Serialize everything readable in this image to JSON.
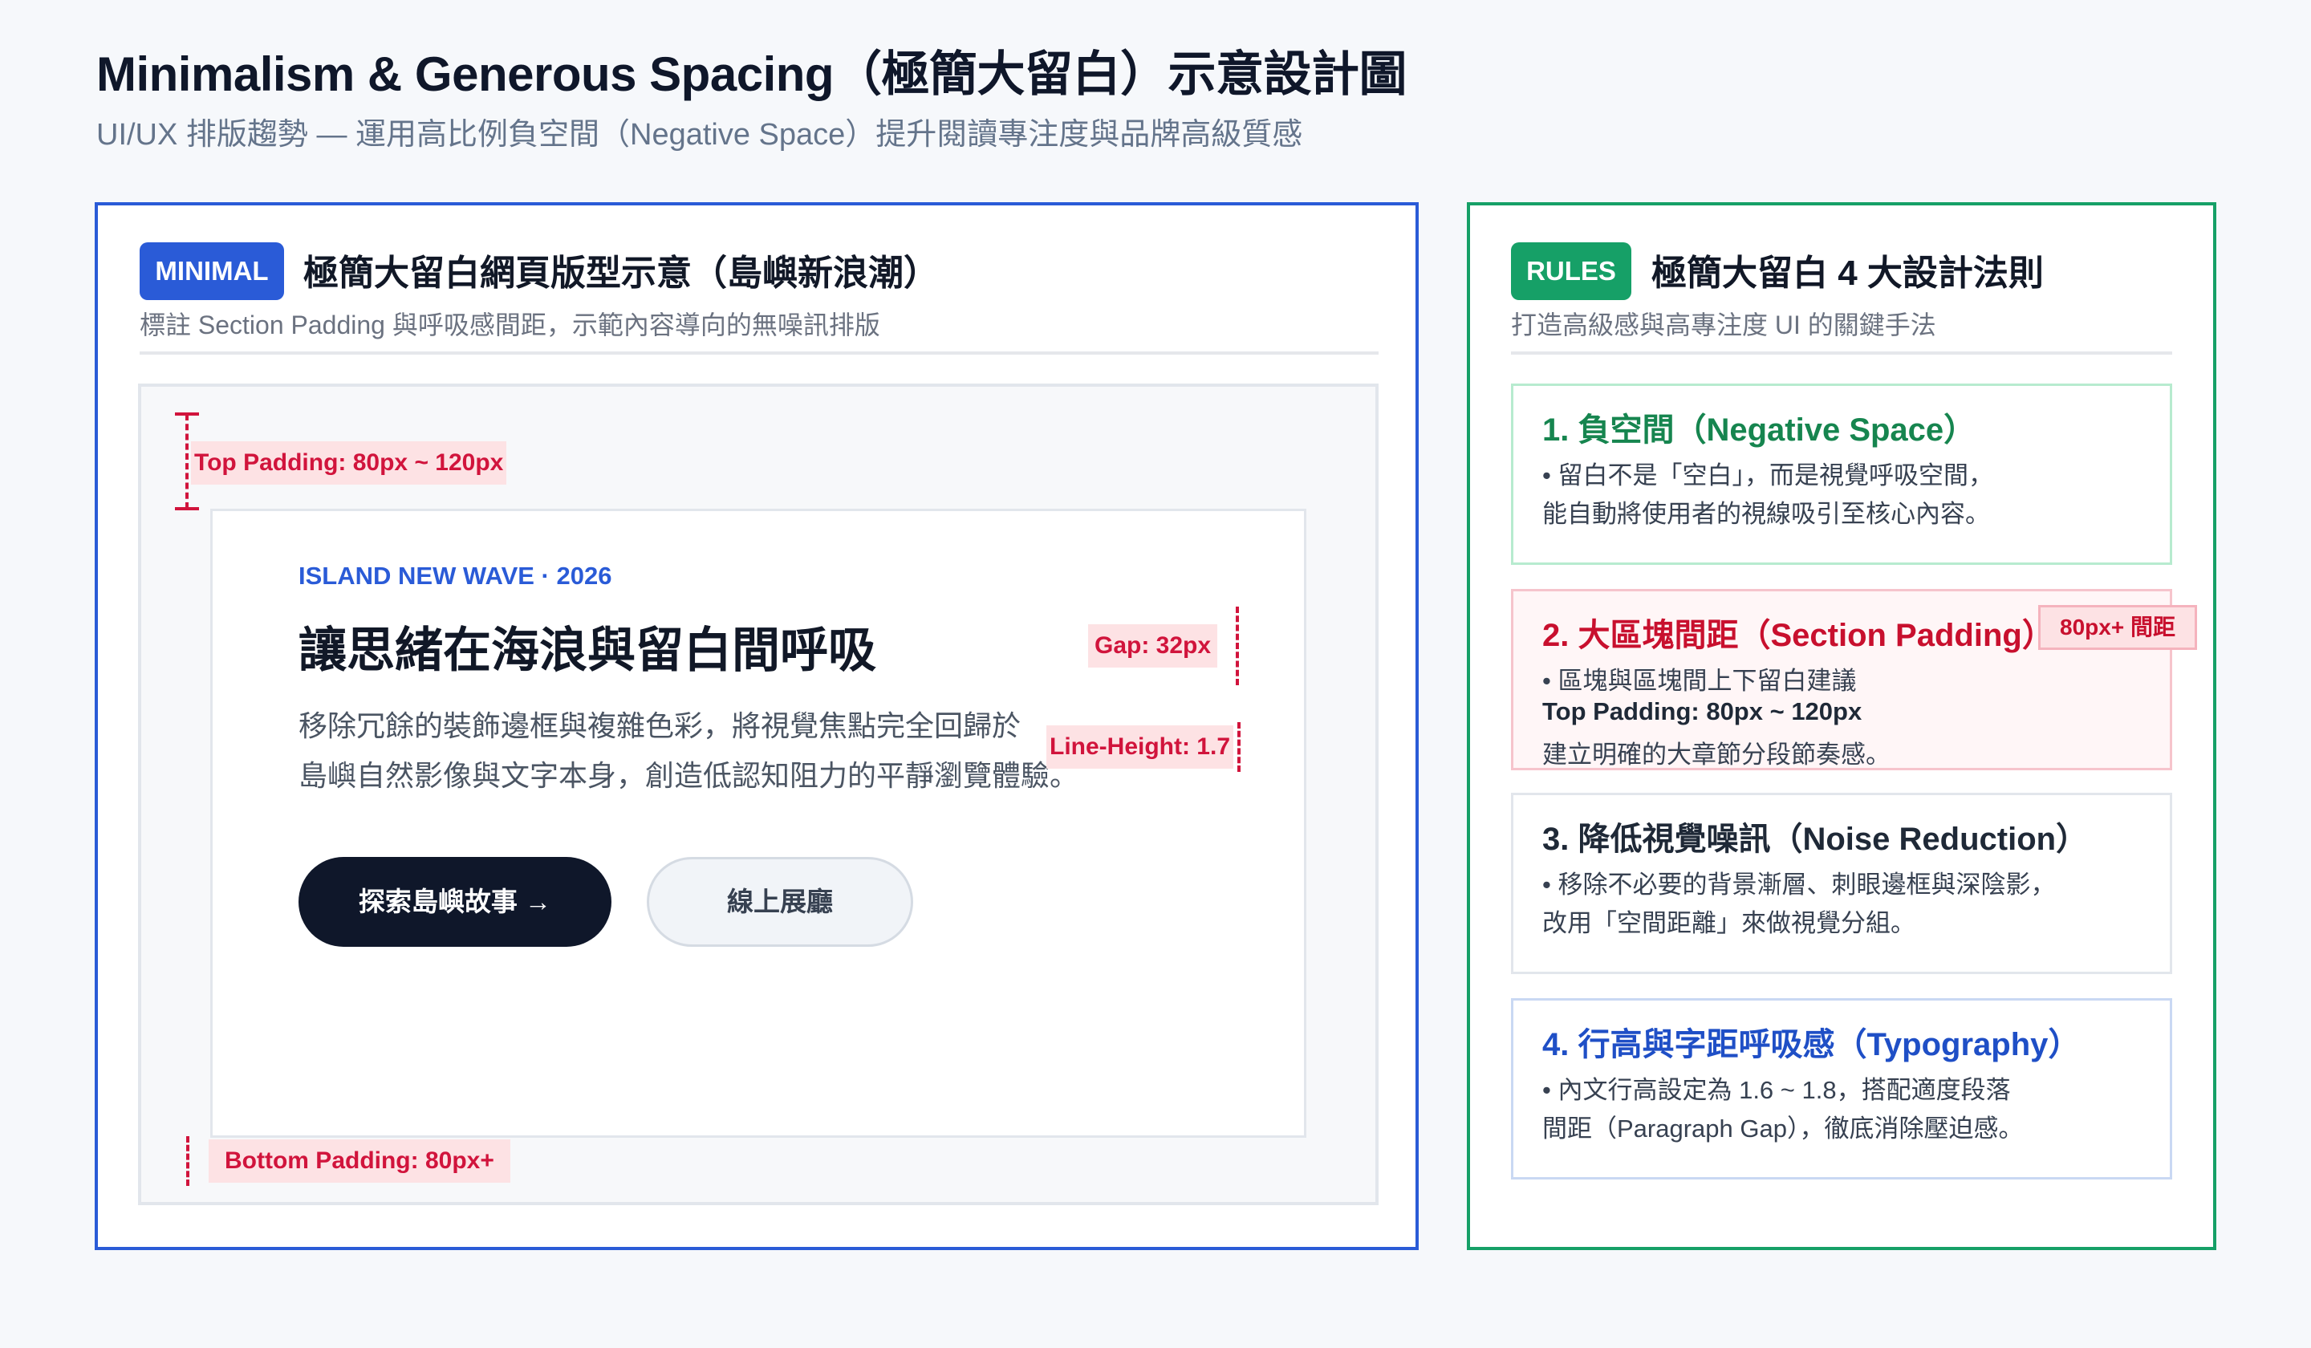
{
  "header": {
    "title": "Minimalism & Generous Spacing（極簡大留白）示意設計圖",
    "subtitle": "UI/UX 排版趨勢 — 運用高比例負空間（Negative Space）提升閱讀專注度與品牌高級質感"
  },
  "left_panel": {
    "tag": "MINIMAL",
    "heading": "極簡大留白網頁版型示意（島嶼新浪潮）",
    "subheading": "標註 Section Padding 與呼吸感間距，示範內容導向的無噪訊排版",
    "annotations": {
      "top_padding": "Top Padding: 80px ~ 120px",
      "gap": "Gap: 32px",
      "line_height": "Line-Height: 1.7",
      "bottom_padding": "Bottom Padding: 80px+"
    },
    "card": {
      "kicker": "ISLAND NEW WAVE · 2026",
      "headline": "讓思緒在海浪與留白間呼吸",
      "body_line_1": "移除冗餘的裝飾邊框與複雜色彩，將視覺焦點完全回歸於",
      "body_line_2": "島嶼自然影像與文字本身，創造低認知阻力的平靜瀏覽體驗。",
      "primary_button": "探索島嶼故事 →",
      "secondary_button": "線上展廳"
    }
  },
  "right_panel": {
    "tag": "RULES",
    "heading": "極簡大留白 4 大設計法則",
    "subheading": "打造高級感與高專注度 UI 的關鍵手法",
    "rules": [
      {
        "title": "1. 負空間（Negative Space）",
        "lines": [
          "• 留白不是「空白」，而是視覺呼吸空間，",
          "能自動將使用者的視線吸引至核心內容。"
        ],
        "color": "#16854f",
        "border": "#b7ebcf"
      },
      {
        "title": "2. 大區塊間距（Section Padding）",
        "badge": "80px+ 間距",
        "lines": [
          "• 區塊與區塊間上下留白建議",
          "Top Padding: 80px ~ 120px",
          "建立明確的大章節分段節奏感。"
        ],
        "color": "#c8102e",
        "border": "#f6c4cc"
      },
      {
        "title": "3. 降低視覺噪訊（Noise Reduction）",
        "lines": [
          "• 移除不必要的背景漸層、刺眼邊框與深陰影，",
          "改用「空間距離」來做視覺分組。"
        ],
        "color": "#1f2937",
        "border": "#e2e6ec"
      },
      {
        "title": "4. 行高與字距呼吸感（Typography）",
        "lines": [
          "• 內文行高設定為 1.6 ~ 1.8，搭配適度段落",
          "間距（Paragraph Gap），徹底消除壓迫感。"
        ],
        "color": "#1f4fc6",
        "border": "#c9d8f3"
      }
    ]
  },
  "colors": {
    "blue": "#2a5bd7",
    "green": "#16a067",
    "red": "#d1143c",
    "dark": "#0f172a"
  }
}
